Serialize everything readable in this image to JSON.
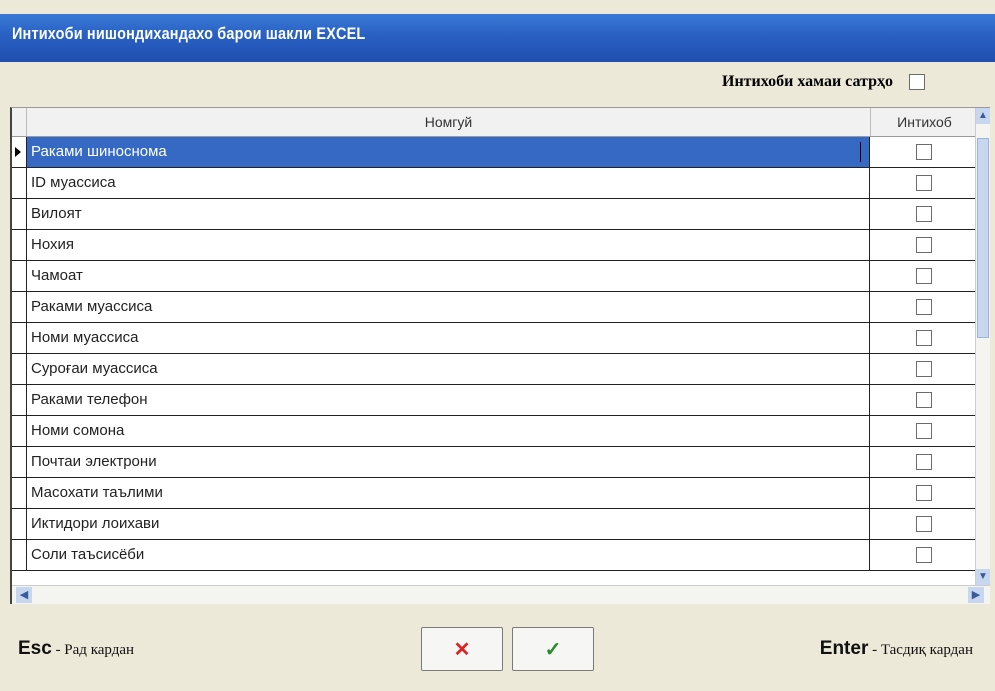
{
  "window": {
    "title": "Интихоби нишондихандахо барои шакли EXCEL"
  },
  "select_all": {
    "label": "Интихоби хамаи сатрҳо",
    "checked": false
  },
  "grid": {
    "columns": [
      "Номгуй",
      "Интихоб"
    ],
    "rows": [
      {
        "name": "Раками шиноснома",
        "checked": false
      },
      {
        "name": "ID муассиса",
        "checked": false
      },
      {
        "name": "Вилоят",
        "checked": false
      },
      {
        "name": "Нохия",
        "checked": false
      },
      {
        "name": "Чамоат",
        "checked": false
      },
      {
        "name": "Раками муассиса",
        "checked": false
      },
      {
        "name": "Номи муассиса",
        "checked": false
      },
      {
        "name": "Суроғаи муассиса",
        "checked": false
      },
      {
        "name": "Раками телефон",
        "checked": false
      },
      {
        "name": "Номи сомона",
        "checked": false
      },
      {
        "name": "Почтаи электрони",
        "checked": false
      },
      {
        "name": "Масохати таълими",
        "checked": false
      },
      {
        "name": "Иктидори лоихави",
        "checked": false
      },
      {
        "name": "Соли таъсисёби",
        "checked": false
      }
    ],
    "selected_row": 0
  },
  "footer": {
    "esc_key": "Esc",
    "esc_action": " - Рад кардан",
    "enter_key": "Enter",
    "enter_action": " - Тасдиқ кардан",
    "cancel_symbol": "✕",
    "ok_symbol": "✓"
  },
  "icons": {
    "row_indicator": "triangle-right-icon",
    "scroll_up": "chevron-up-icon",
    "scroll_down": "chevron-down-icon",
    "scroll_left": "chevron-left-icon",
    "scroll_right": "chevron-right-icon"
  },
  "colors": {
    "titlebar": "#2a62c4",
    "selection": "#3569c4",
    "cancel": "#d22222",
    "ok": "#2a8a2a"
  }
}
